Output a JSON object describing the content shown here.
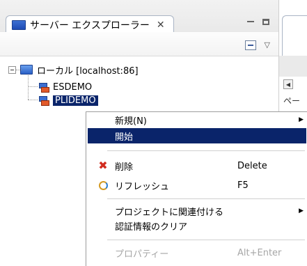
{
  "view": {
    "title": "サーバー エクスプローラー",
    "close_glyph": "✕"
  },
  "tree": {
    "root": {
      "label": "ローカル [localhost:86]"
    },
    "children": [
      {
        "label": "ESDEMO"
      },
      {
        "label": "PLIDEMO"
      }
    ]
  },
  "right_pane": {
    "text": "ペー"
  },
  "context_menu": {
    "items": [
      {
        "label": "新規(N)",
        "shortcut": ""
      },
      {
        "label": "開始",
        "shortcut": ""
      },
      {
        "label": "削除",
        "shortcut": "Delete"
      },
      {
        "label": "リフレッシュ",
        "shortcut": "F5"
      },
      {
        "label": "プロジェクトに関連付ける",
        "shortcut": ""
      },
      {
        "label": "認証情報のクリア",
        "shortcut": ""
      },
      {
        "label": "プロパティー",
        "shortcut": "Alt+Enter"
      }
    ]
  },
  "colors": {
    "selection": "#0a246a",
    "disabled_text": "#a6a6a6",
    "delete_icon": "#d12b1e"
  },
  "icons": [
    "server-view-icon",
    "close-icon",
    "minimize-icon",
    "maximize-icon",
    "collapse-all-icon",
    "view-menu-icon",
    "local-server-icon",
    "database-icon",
    "delete-icon",
    "refresh-icon",
    "submenu-arrow-icon",
    "scroll-left-icon"
  ]
}
